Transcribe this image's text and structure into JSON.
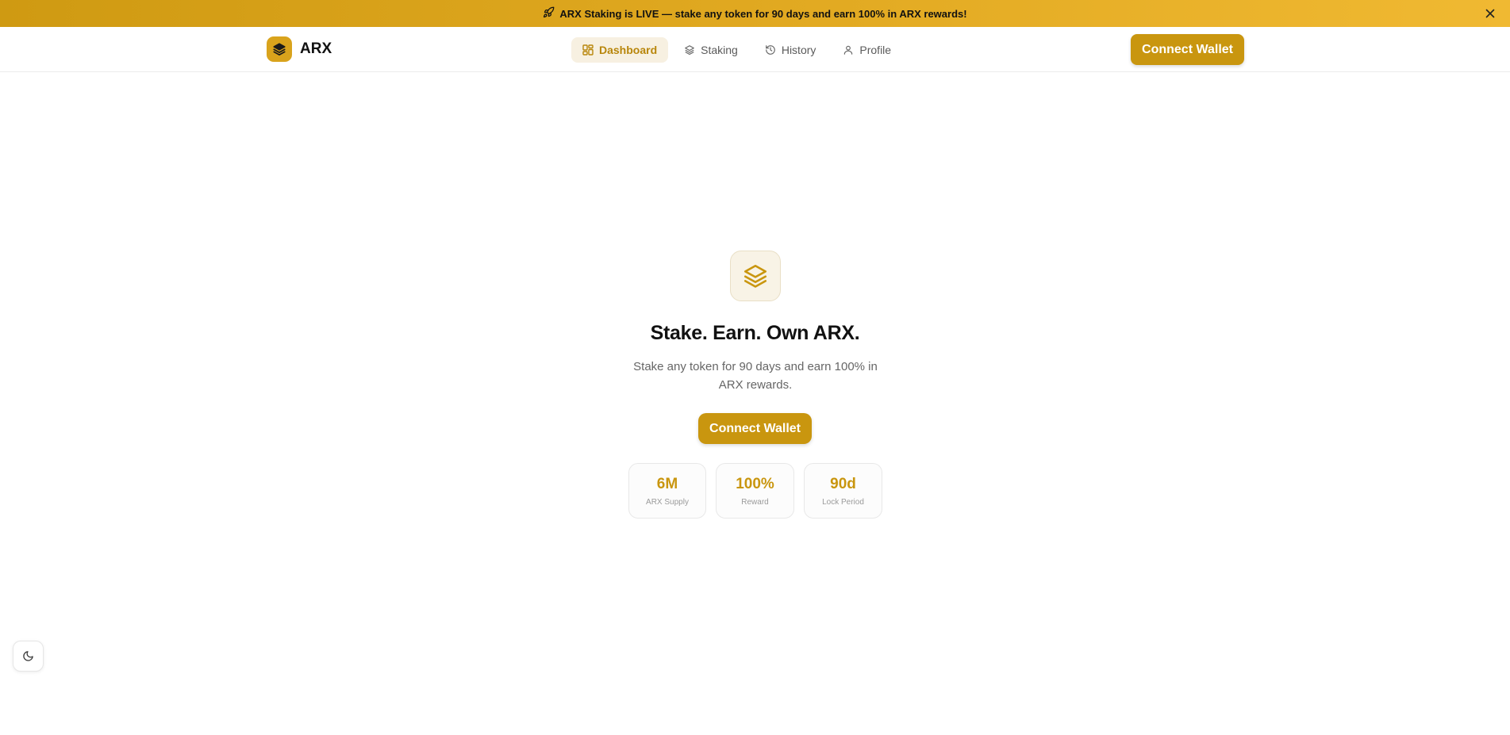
{
  "banner": {
    "text": "ARX Staking is LIVE — stake any token for 90 days and earn 100% in ARX rewards!",
    "icon": "rocket-icon",
    "close_icon": "close-icon"
  },
  "header": {
    "brand_name": "ARX",
    "nav": [
      {
        "label": "Dashboard",
        "icon": "dashboard-grid-icon",
        "active": true
      },
      {
        "label": "Staking",
        "icon": "layers-icon",
        "active": false
      },
      {
        "label": "History",
        "icon": "history-icon",
        "active": false
      },
      {
        "label": "Profile",
        "icon": "user-icon",
        "active": false
      }
    ],
    "connect_label": "Connect Wallet"
  },
  "hero": {
    "title": "Stake. Earn. Own ARX.",
    "subtitle": "Stake any token for 90 days and earn 100% in ARX rewards.",
    "connect_label": "Connect Wallet"
  },
  "stats": [
    {
      "value": "6M",
      "label": "ARX Supply"
    },
    {
      "value": "100%",
      "label": "Reward"
    },
    {
      "value": "90d",
      "label": "Lock Period"
    }
  ],
  "colors": {
    "accent": "#c9960f",
    "banner_start": "#cf9a12",
    "banner_end": "#f0b932"
  },
  "theme_toggle_icon": "moon-icon"
}
